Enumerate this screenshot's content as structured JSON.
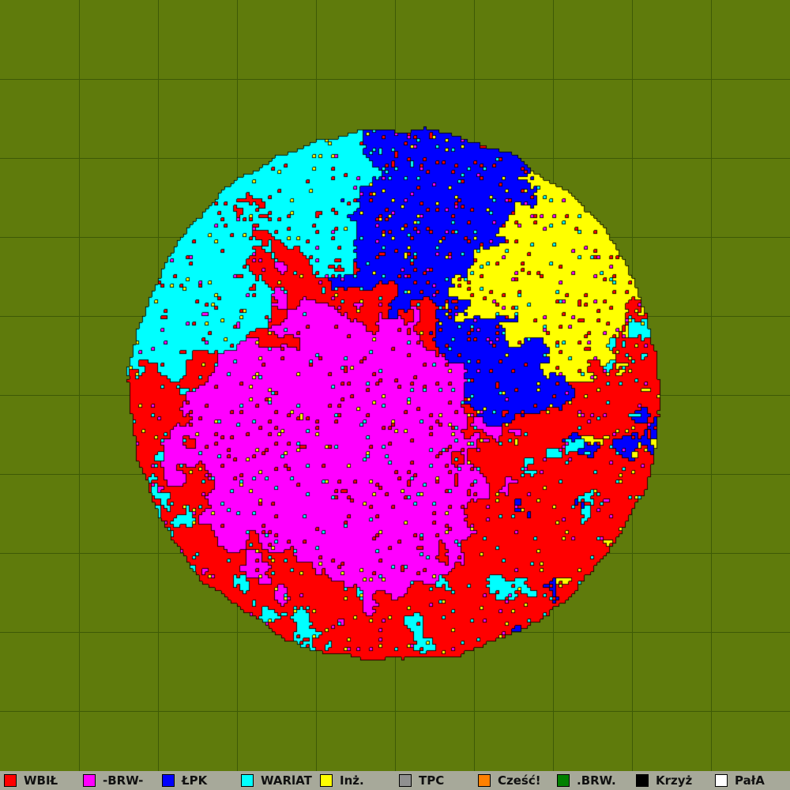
{
  "board": {
    "background_color": "#5f7b0c",
    "grid_color": "#3d5a06",
    "grid_columns": 10,
    "grid_rows": 10
  },
  "teams": [
    {
      "label": "WBIŁ",
      "color": "#ff0000"
    },
    {
      "label": "-BRW-",
      "color": "#ff00ff"
    },
    {
      "label": "ŁPK",
      "color": "#0000ff"
    },
    {
      "label": "WARlAT",
      "color": "#00ffff"
    },
    {
      "label": "Inż.",
      "color": "#ffff00"
    },
    {
      "label": "TPC",
      "color": "#909090"
    },
    {
      "label": "Cześć!",
      "color": "#ff8000"
    },
    {
      "label": ".BRW.",
      "color": "#008000"
    },
    {
      "label": "Krzyż",
      "color": "#000000"
    },
    {
      "label": "PałA",
      "color": "#ffffff"
    }
  ]
}
